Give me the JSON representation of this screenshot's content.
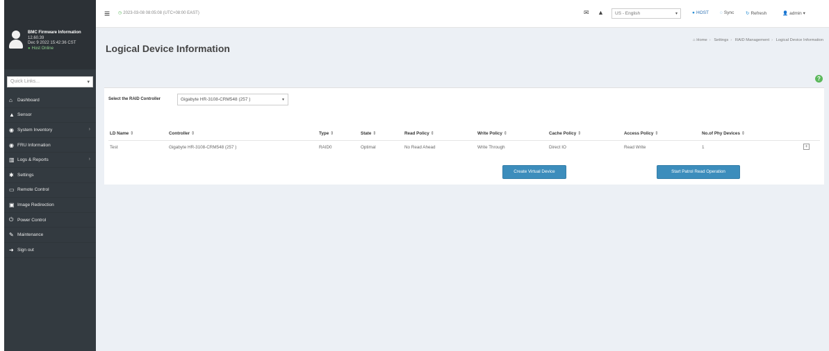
{
  "sidebar": {
    "fw_title": "BMC Firmware Information",
    "fw_version": "12.60.39",
    "fw_date": "Dec 9 2022 15:42:36 CST",
    "host_status": "Host Online",
    "quick_links_placeholder": "Quick Links...",
    "items": [
      {
        "label": "Dashboard",
        "icon": "tachometer-icon",
        "has_submenu": false
      },
      {
        "label": "Sensor",
        "icon": "sensor-icon",
        "has_submenu": false
      },
      {
        "label": "System Inventory",
        "icon": "inventory-icon",
        "has_submenu": true
      },
      {
        "label": "FRU Information",
        "icon": "info-icon",
        "has_submenu": false
      },
      {
        "label": "Logs & Reports",
        "icon": "bar-chart-icon",
        "has_submenu": true
      },
      {
        "label": "Settings",
        "icon": "gear-icon",
        "has_submenu": false
      },
      {
        "label": "Remote Control",
        "icon": "monitor-icon",
        "has_submenu": false
      },
      {
        "label": "Image Redirection",
        "icon": "image-icon",
        "has_submenu": false
      },
      {
        "label": "Power Control",
        "icon": "power-icon",
        "has_submenu": false
      },
      {
        "label": "Maintenance",
        "icon": "wrench-icon",
        "has_submenu": false
      },
      {
        "label": "Sign out",
        "icon": "sign-out-icon",
        "has_submenu": false
      }
    ]
  },
  "topbar": {
    "datetime": "2023-03-08 08:05:08 (UTC+08:00 EAST)",
    "language": "US - English",
    "host_label": "HOST",
    "sync_label": "Sync",
    "refresh_label": "Refresh",
    "user_label": "admin"
  },
  "page": {
    "title": "Logical Device Information",
    "breadcrumb": [
      "Home",
      "Settings",
      "RAID Management",
      "Logical Device Information"
    ]
  },
  "controller": {
    "label": "Select the RAID Controller",
    "selected": "Gigabyte HR-3108-CRM548 (257 )"
  },
  "table": {
    "headers": [
      "LD Name",
      "Controller",
      "Type",
      "State",
      "Read Policy",
      "Write Policy",
      "Cache Policy",
      "Access Policy",
      "No.of Phy Devices"
    ],
    "rows": [
      [
        "Test",
        "Gigabyte HR-3108-CRM548 (257 )",
        "RAID0",
        "Optimal",
        "No Read Ahead",
        "Write Through",
        "Direct IO",
        "Read Write",
        "1"
      ]
    ]
  },
  "actions": {
    "create_virtual": "Create Virtual Device",
    "patrol_read": "Start Patrol Read Operation"
  },
  "colors": {
    "sidebar_bg": "#333a40",
    "content_bg": "#ecf0f5",
    "primary_button": "#3c8dbc",
    "status_green": "#5cb85c"
  }
}
